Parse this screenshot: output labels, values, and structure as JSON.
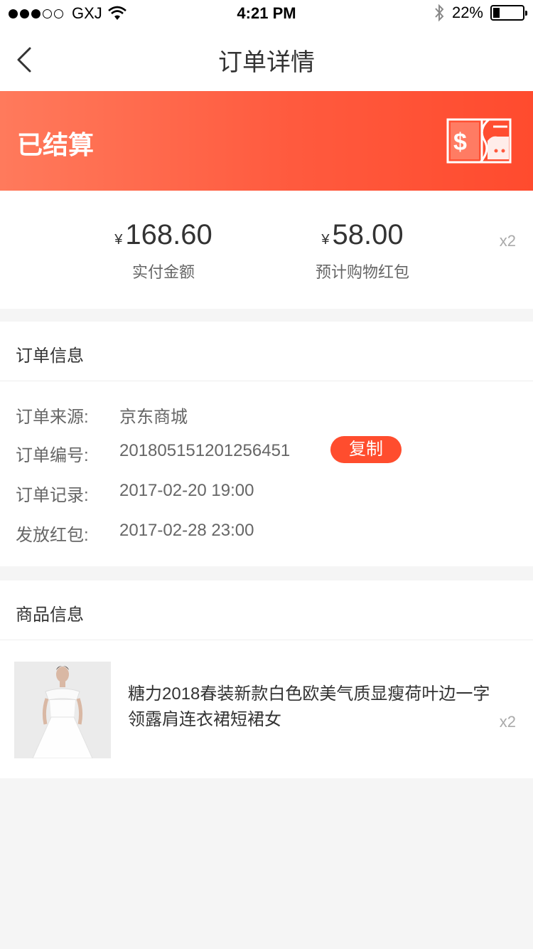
{
  "status_bar": {
    "carrier": "GXJ",
    "time": "4:21 PM",
    "battery_percent": "22%",
    "battery_level": 0.22,
    "signal_filled": 3,
    "signal_total": 5
  },
  "nav": {
    "back_icon": "chevron-left-icon",
    "title": "订单详情"
  },
  "banner": {
    "status": "已结算",
    "icon": "money-card-icon",
    "gradient": [
      "#ff7a5c",
      "#ff4b2e"
    ]
  },
  "amounts": {
    "currency": "¥",
    "paid_value": "168.60",
    "paid_label": "实付金额",
    "redpacket_value": "58.00",
    "redpacket_label": "预计购物红包",
    "multiplier": "x2"
  },
  "order_info": {
    "title": "订单信息",
    "rows": [
      {
        "label": "订单来源:",
        "value": "京东商城"
      },
      {
        "label": "订单编号:",
        "value": "201805151201256451"
      },
      {
        "label": "订单记录:",
        "value": "2017-02-20 19:00"
      },
      {
        "label": "发放红包:",
        "value": "2017-02-28 23:00"
      }
    ],
    "copy_label": "复制",
    "accent": "#ff4d2e"
  },
  "goods_info": {
    "title": "商品信息",
    "product": {
      "title": "糖力2018春装新款白色欧美气质显瘦荷叶边一字领露肩连衣裙短裙女",
      "quantity": "x2"
    }
  }
}
